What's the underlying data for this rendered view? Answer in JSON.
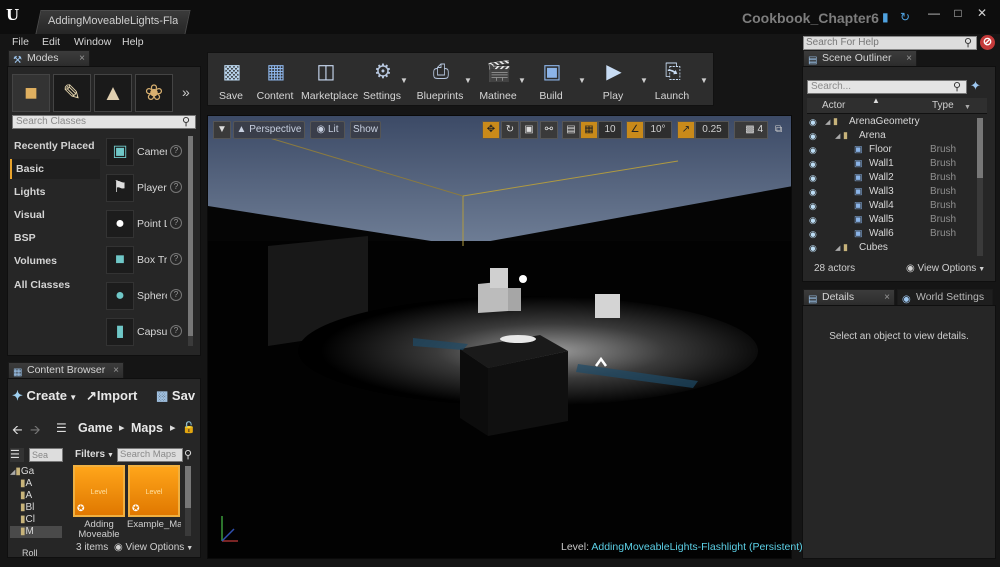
{
  "titlebar": {
    "tab_label": "AddingMoveableLights-Flash",
    "project_name": "Cookbook_Chapter6"
  },
  "menu": [
    "File",
    "Edit",
    "Window",
    "Help"
  ],
  "help_search_placeholder": "Search For Help",
  "modes": {
    "tab_label": "Modes",
    "search_placeholder": "Search Classes",
    "categories": [
      "Recently Placed",
      "Basic",
      "Lights",
      "Visual",
      "BSP",
      "Volumes",
      "All Classes"
    ],
    "selected_category": "Basic",
    "items": [
      "Camera",
      "Player Start",
      "Point Light",
      "Box Trigger",
      "Sphere Trigger",
      "Capsule Trigger"
    ]
  },
  "toolbar": {
    "buttons": [
      "Save",
      "Content",
      "Marketplace",
      "Settings",
      "Blueprints",
      "Matinee",
      "Build",
      "Play",
      "Launch"
    ]
  },
  "viewport": {
    "perspective_label": "Perspective",
    "lit_label": "Lit",
    "show_label": "Show",
    "grid_snap": "10",
    "rot_snap": "10°",
    "scale_snap": "0.25",
    "cam_speed": "4",
    "level_prefix": "Level:",
    "level_name": "AddingMoveableLights-Flashlight (Persistent)"
  },
  "content_browser": {
    "tab_label": "Content Browser",
    "create_label": "Create",
    "import_label": "Import",
    "save_label": "Sav",
    "path": [
      "Game",
      "Maps"
    ],
    "filters_label": "Filters",
    "search_placeholder": "Search Maps",
    "folder_search_placeholder": "Sea",
    "folder_tree": [
      "Ga",
      "A",
      "A",
      "Bl",
      "Cl",
      "M",
      "Roll"
    ],
    "assets": [
      {
        "type": "Level",
        "name": "Adding Moveable"
      },
      {
        "type": "Level",
        "name": "Example_Map"
      }
    ],
    "item_count": "3 items",
    "view_options": "View Options"
  },
  "outliner": {
    "tab_label": "Scene Outliner",
    "search_placeholder": "Search...",
    "col_actor": "Actor",
    "col_type": "Type",
    "rows": [
      {
        "name": "ArenaGeometry",
        "type": "",
        "kind": "folder"
      },
      {
        "name": "Arena",
        "type": "",
        "kind": "folder"
      },
      {
        "name": "Floor",
        "type": "Brush",
        "kind": "brush"
      },
      {
        "name": "Wall1",
        "type": "Brush",
        "kind": "brush"
      },
      {
        "name": "Wall2",
        "type": "Brush",
        "kind": "brush"
      },
      {
        "name": "Wall3",
        "type": "Brush",
        "kind": "brush"
      },
      {
        "name": "Wall4",
        "type": "Brush",
        "kind": "brush"
      },
      {
        "name": "Wall5",
        "type": "Brush",
        "kind": "brush"
      },
      {
        "name": "Wall6",
        "type": "Brush",
        "kind": "brush"
      },
      {
        "name": "Cubes",
        "type": "",
        "kind": "folder"
      }
    ],
    "actor_count": "28 actors",
    "view_options": "View Options"
  },
  "details": {
    "tab_label": "Details",
    "world_tab_label": "World Settings",
    "empty_message": "Select an object to view details."
  }
}
